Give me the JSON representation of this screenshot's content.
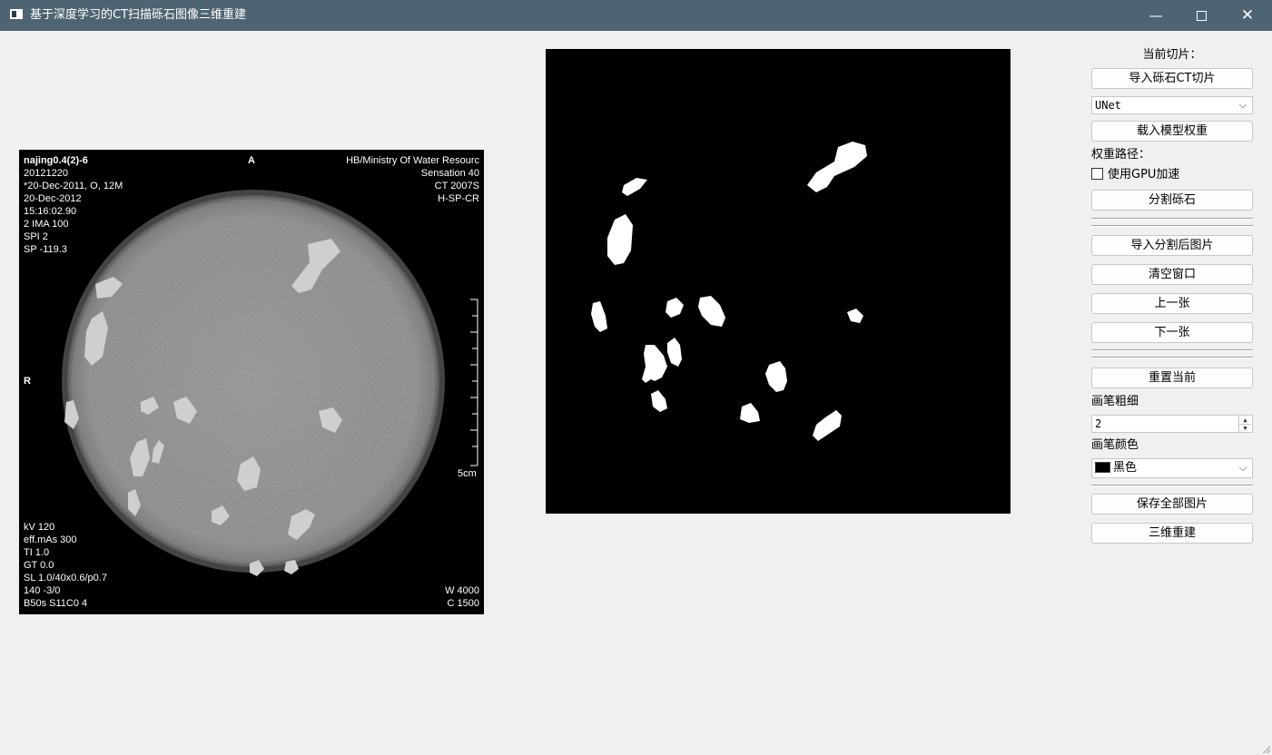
{
  "window": {
    "title": "基于深度学习的CT扫描砾石图像三维重建",
    "minimize_glyph": "—",
    "close_glyph": "✕"
  },
  "ct_image": {
    "overlay_top_left": [
      "najing0.4(2)-6",
      "20121220",
      "*20-Dec-2011, O, 12M",
      "20-Dec-2012",
      "15:16:02.90",
      "2 IMA 100",
      "SPI 2",
      "SP -119.3"
    ],
    "overlay_top_right": [
      "HB/Ministry Of Water Resourc",
      "Sensation 40",
      "CT 2007S",
      "H-SP-CR"
    ],
    "overlay_bottom_left": [
      "kV 120",
      "eff.mAs 300",
      "TI 1.0",
      "GT 0.0",
      "SL 1.0/40x0.6/p0.7",
      "140 -3/0",
      "B50s S11C0  4"
    ],
    "overlay_bottom_right": [
      "W  4000",
      "C  1500"
    ],
    "orientation_top": "A",
    "orientation_left": "R",
    "scale_label": "5cm"
  },
  "panel": {
    "current_slice_label": "当前切片：",
    "import_ct_button": "导入砾石CT切片",
    "model_select": "UNet",
    "load_weights_button": "载入模型权重",
    "weights_path_label": "权重路径：",
    "gpu_checkbox_label": "使用GPU加速",
    "segment_button": "分割砾石",
    "import_segmented_button": "导入分割后图片",
    "clear_window_button": "清空窗口",
    "prev_button": "上一张",
    "next_button": "下一张",
    "reset_current_button": "重置当前",
    "brush_size_label": "画笔粗细",
    "brush_size_value": "2",
    "brush_color_label": "画笔颜色",
    "brush_color_value": "黑色",
    "brush_color_swatch": "#000000",
    "save_all_button": "保存全部图片",
    "reconstruct_button": "三维重建"
  },
  "colors": {
    "titlebar": "#4f6472",
    "window_bg": "#f0f0f0"
  }
}
